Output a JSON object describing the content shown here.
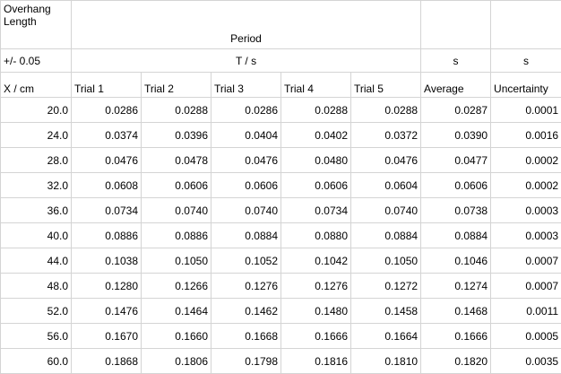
{
  "header": {
    "overhang_length": "Overhang Length",
    "period": "Period",
    "uncertainty_x": "+/- 0.05",
    "t_unit": "T / s",
    "avg_unit": "s",
    "unc_unit": "s"
  },
  "columns": [
    "X / cm",
    "Trial 1",
    "Trial 2",
    "Trial 3",
    "Trial 4",
    "Trial 5",
    "Average",
    "Uncertainty"
  ],
  "rows": [
    [
      "20.0",
      "0.0286",
      "0.0288",
      "0.0286",
      "0.0288",
      "0.0288",
      "0.0287",
      "0.0001"
    ],
    [
      "24.0",
      "0.0374",
      "0.0396",
      "0.0404",
      "0.0402",
      "0.0372",
      "0.0390",
      "0.0016"
    ],
    [
      "28.0",
      "0.0476",
      "0.0478",
      "0.0476",
      "0.0480",
      "0.0476",
      "0.0477",
      "0.0002"
    ],
    [
      "32.0",
      "0.0608",
      "0.0606",
      "0.0606",
      "0.0606",
      "0.0604",
      "0.0606",
      "0.0002"
    ],
    [
      "36.0",
      "0.0734",
      "0.0740",
      "0.0740",
      "0.0734",
      "0.0740",
      "0.0738",
      "0.0003"
    ],
    [
      "40.0",
      "0.0886",
      "0.0886",
      "0.0884",
      "0.0880",
      "0.0884",
      "0.0884",
      "0.0003"
    ],
    [
      "44.0",
      "0.1038",
      "0.1050",
      "0.1052",
      "0.1042",
      "0.1050",
      "0.1046",
      "0.0007"
    ],
    [
      "48.0",
      "0.1280",
      "0.1266",
      "0.1276",
      "0.1276",
      "0.1272",
      "0.1274",
      "0.0007"
    ],
    [
      "52.0",
      "0.1476",
      "0.1464",
      "0.1462",
      "0.1480",
      "0.1458",
      "0.1468",
      "0.0011"
    ],
    [
      "56.0",
      "0.1670",
      "0.1660",
      "0.1668",
      "0.1666",
      "0.1664",
      "0.1666",
      "0.0005"
    ],
    [
      "60.0",
      "0.1868",
      "0.1806",
      "0.1798",
      "0.1816",
      "0.1810",
      "0.1820",
      "0.0035"
    ]
  ],
  "colors": {
    "gridline": "#d4d4d4",
    "text": "#000000",
    "background": "#ffffff"
  }
}
